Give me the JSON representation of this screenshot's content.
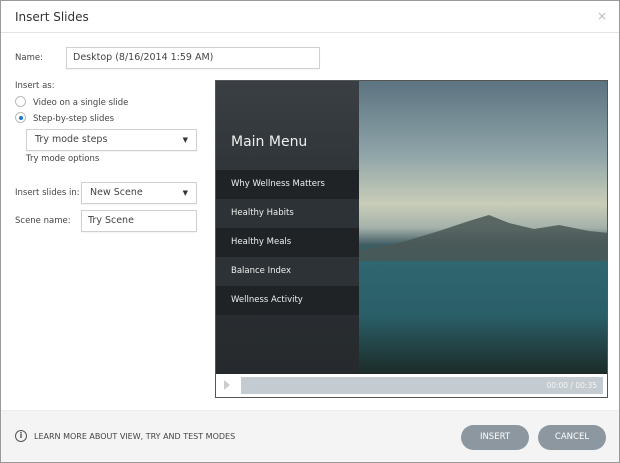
{
  "dialog": {
    "title": "Insert Slides",
    "close": "×"
  },
  "form": {
    "name_label": "Name:",
    "name_value": "Desktop (8/16/2014 1:59 AM)",
    "insert_as_label": "Insert as:",
    "option_video": "Video on a single slide",
    "option_steps": "Step-by-step slides",
    "selected_option": "Step-by-step slides",
    "try_mode_value": "Try mode steps",
    "try_mode_options_label": "Try mode options",
    "insert_in_label": "Insert slides in:",
    "insert_in_value": "New Scene",
    "scene_name_label": "Scene name:",
    "scene_name_value": "Try Scene",
    "dropdown_arrow": "▼"
  },
  "preview": {
    "menu_title": "Main Menu",
    "menu_items": [
      "Why Wellness Matters",
      "Healthy Habits",
      "Healthy Meals",
      "Balance Index",
      "Wellness Activity"
    ],
    "time": "00:00 / 00:35",
    "progress": 0
  },
  "footer": {
    "info": "i",
    "learn_more": "LEARN MORE ABOUT VIEW, TRY AND TEST MODES",
    "insert": "INSERT",
    "cancel": "CANCEL"
  }
}
